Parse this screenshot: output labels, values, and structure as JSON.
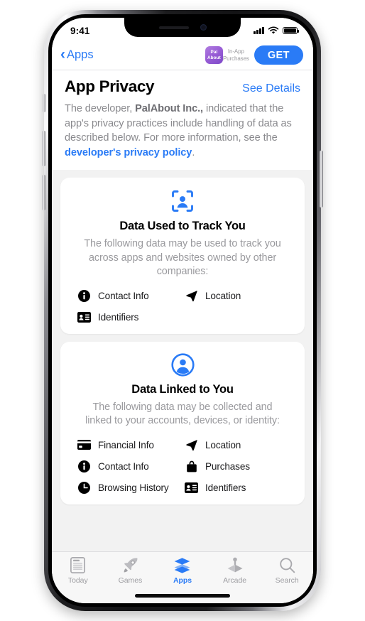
{
  "status_bar": {
    "time": "9:41",
    "signal_icon": "cellular-bars-icon",
    "wifi_icon": "wifi-icon",
    "battery_icon": "battery-full-icon"
  },
  "nav_bar": {
    "back_label": "Apps",
    "back_icon": "chevron-left-icon",
    "app_icon_line1": "Pal",
    "app_icon_line2": "About",
    "iap_line1": "In-App",
    "iap_line2": "Purchases",
    "get_label": "GET"
  },
  "page": {
    "title": "App Privacy",
    "see_details_label": "See Details",
    "intro_part1": "The developer, ",
    "intro_developer": "PalAbout Inc.,",
    "intro_part2": " indicated that the app's privacy practices include handling of data as described below. For more information, see the ",
    "intro_link": "developer's privacy policy",
    "intro_part3": "."
  },
  "cards": [
    {
      "icon": "person-in-viewfinder-icon",
      "title": "Data Used to Track You",
      "description": "The following data may be used to track you across apps and websites owned by other companies:",
      "items": [
        {
          "icon": "info-circle-icon",
          "label": "Contact Info"
        },
        {
          "icon": "location-arrow-icon",
          "label": "Location"
        },
        {
          "icon": "id-card-icon",
          "label": "Identifiers"
        }
      ]
    },
    {
      "icon": "person-circle-icon",
      "title": "Data Linked to You",
      "description": "The following data may be collected and linked to your accounts, devices, or identity:",
      "items": [
        {
          "icon": "credit-card-icon",
          "label": "Financial Info"
        },
        {
          "icon": "location-arrow-icon",
          "label": "Location"
        },
        {
          "icon": "info-circle-icon",
          "label": "Contact Info"
        },
        {
          "icon": "bag-icon",
          "label": "Purchases"
        },
        {
          "icon": "clock-icon",
          "label": "Browsing History"
        },
        {
          "icon": "id-card-icon",
          "label": "Identifiers"
        }
      ]
    }
  ],
  "tab_bar": {
    "active": "Apps",
    "tabs": [
      {
        "icon": "newspaper-icon",
        "label": "Today"
      },
      {
        "icon": "rocket-icon",
        "label": "Games"
      },
      {
        "icon": "stack-layers-icon",
        "label": "Apps"
      },
      {
        "icon": "joystick-icon",
        "label": "Arcade"
      },
      {
        "icon": "magnifier-icon",
        "label": "Search"
      }
    ]
  },
  "colors": {
    "accent_blue": "#2a7bf6",
    "background_gray": "#f2f2f2",
    "card_white": "#ffffff",
    "muted_text": "#9a9a9e",
    "app_icon_purple": "#8e52cf"
  }
}
